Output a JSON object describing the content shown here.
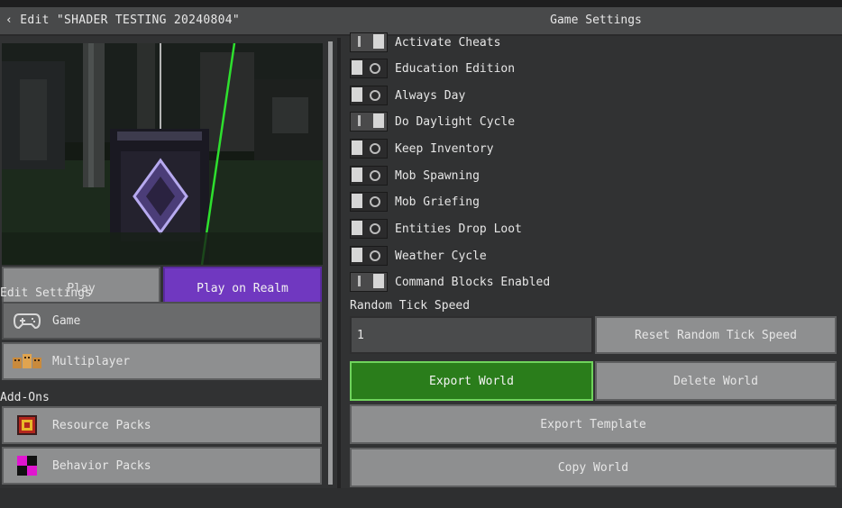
{
  "header": {
    "back_label": "‹ Edit \"SHADER TESTING 20240804\"",
    "title": "Game Settings"
  },
  "preview": {
    "play_label": "Play",
    "play_realm_label": "Play on Realm"
  },
  "sidebar": {
    "edit_settings_heading": "Edit Settings",
    "addons_heading": "Add-Ons",
    "items": [
      {
        "label": "Game",
        "icon": "controller-icon",
        "selected": true
      },
      {
        "label": "Multiplayer",
        "icon": "multiplayer-icon",
        "selected": false
      },
      {
        "label": "Resource Packs",
        "icon": "resource-pack-icon",
        "selected": false
      },
      {
        "label": "Behavior Packs",
        "icon": "behavior-pack-icon",
        "selected": false
      }
    ]
  },
  "settings": {
    "toggles": [
      {
        "label": "Activate Cheats",
        "on": true
      },
      {
        "label": "Education Edition",
        "on": false
      },
      {
        "label": "Always Day",
        "on": false
      },
      {
        "label": "Do Daylight Cycle",
        "on": true
      },
      {
        "label": "Keep Inventory",
        "on": false
      },
      {
        "label": "Mob Spawning",
        "on": false
      },
      {
        "label": "Mob Griefing",
        "on": false
      },
      {
        "label": "Entities Drop Loot",
        "on": false
      },
      {
        "label": "Weather Cycle",
        "on": false
      },
      {
        "label": "Command Blocks Enabled",
        "on": true
      }
    ],
    "random_tick_label": "Random Tick Speed",
    "random_tick_value": "1",
    "reset_tick_label": "Reset Random Tick Speed",
    "export_world_label": "Export World",
    "delete_world_label": "Delete World",
    "export_template_label": "Export Template",
    "copy_world_label": "Copy World"
  },
  "colors": {
    "accent_purple": "#7038c0",
    "export_green": "#2a7d1b",
    "panel_gray": "#8e8f90"
  }
}
